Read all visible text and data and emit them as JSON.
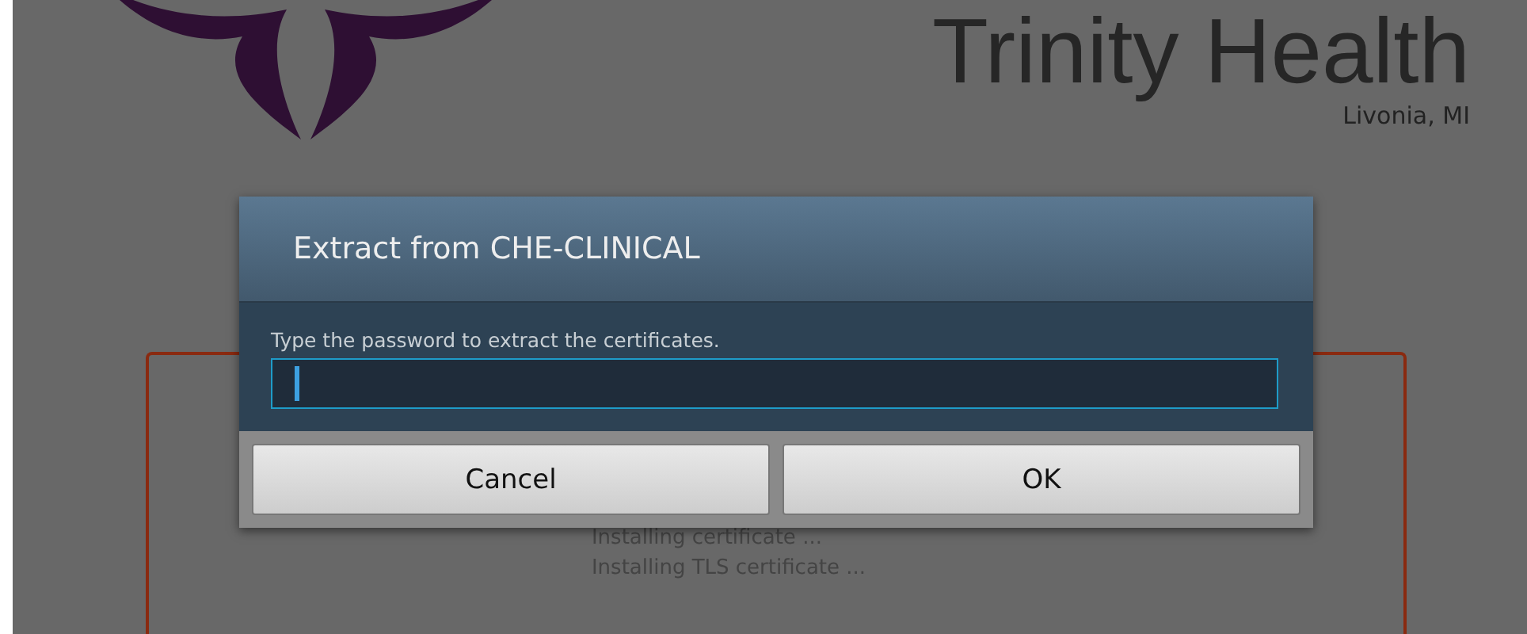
{
  "header": {
    "title": "Trinity Health",
    "location": "Livonia, MI"
  },
  "progress": {
    "lines": [
      "Installing certificate ...",
      "Installing TLS certificate ..."
    ]
  },
  "dialog": {
    "title": "Extract from CHE-CLINICAL",
    "prompt": "Type the password to extract the certificates.",
    "field": {
      "focused": true
    },
    "buttons": [
      {
        "label": "Cancel"
      },
      {
        "label": "OK"
      }
    ]
  }
}
